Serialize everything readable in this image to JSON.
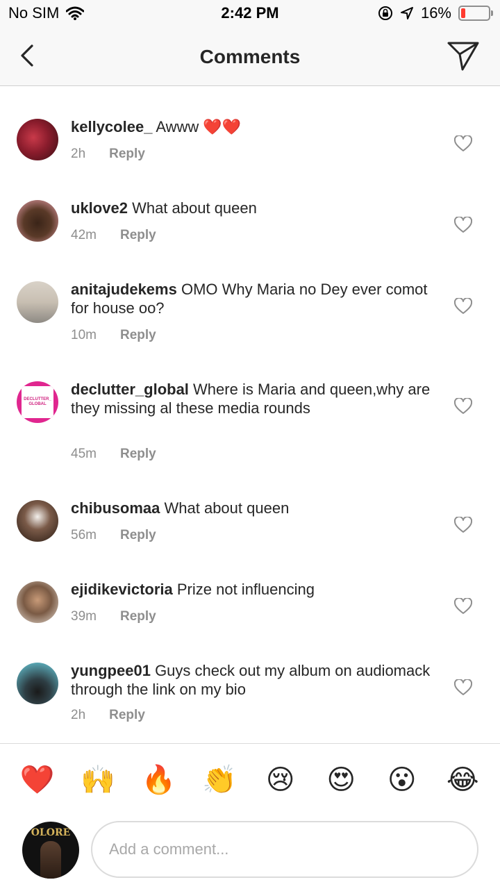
{
  "status_bar": {
    "carrier": "No SIM",
    "time": "2:42 PM",
    "battery_text": "16%",
    "battery_level": 0.16,
    "battery_color": "#ff3b30"
  },
  "header": {
    "title": "Comments",
    "back_icon": "chevron-left-icon",
    "send_icon": "paper-plane-icon"
  },
  "comments": [
    {
      "username": "kellycolee_",
      "text": "Awww ❤️❤️",
      "time": "2h",
      "reply": "Reply"
    },
    {
      "username": "uklove2",
      "text": "What about queen",
      "time": "42m",
      "reply": "Reply"
    },
    {
      "username": "anitajudekems",
      "text": "OMO Why Maria no Dey ever comot for house oo?",
      "time": "10m",
      "reply": "Reply"
    },
    {
      "username": "declutter_global",
      "text": "Where is Maria and queen,why are they missing al these media rounds",
      "time": "45m",
      "reply": "Reply"
    },
    {
      "username": "chibusomaa",
      "text": "What about queen",
      "time": "56m",
      "reply": "Reply"
    },
    {
      "username": "ejidikevictoria",
      "text": "Prize not influencing",
      "time": "39m",
      "reply": "Reply"
    },
    {
      "username": "yungpee01",
      "text": "Guys check out my album on audiomack through the link on my bio",
      "time": "2h",
      "reply": "Reply"
    }
  ],
  "declutter_avatar_text": "DECLUTTER_ GLOBAL",
  "emoji_bar": [
    "❤️",
    "🙌",
    "🔥",
    "👏",
    "😢",
    "😍",
    "😮",
    "😂"
  ],
  "composer": {
    "placeholder": "Add a comment...",
    "avatar_text": "OLORE"
  }
}
